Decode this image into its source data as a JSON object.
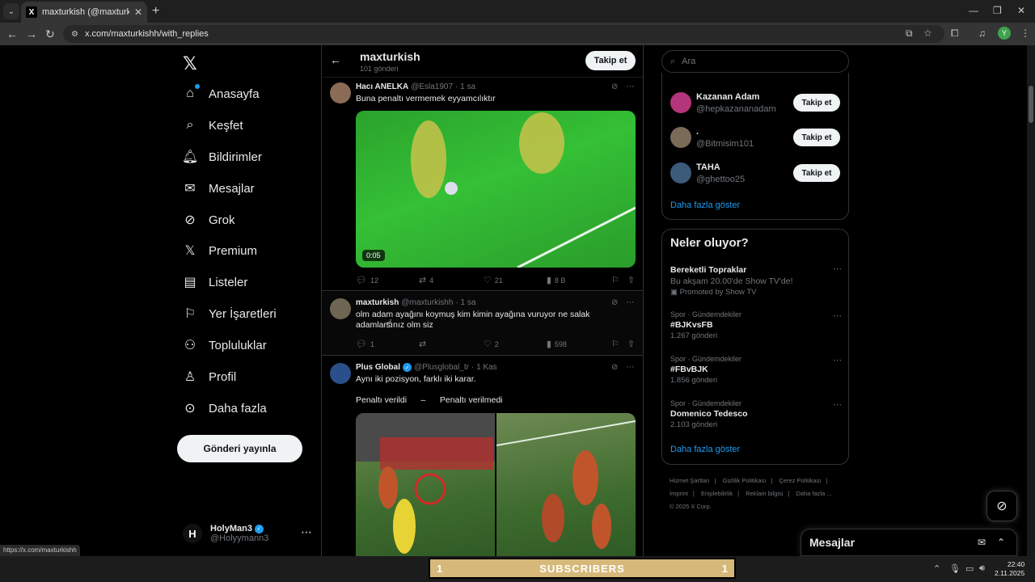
{
  "browser": {
    "tab_title": "maxturkish (@maxturkishh) adlı",
    "url": "x.com/maxturkishh/with_replies",
    "status_url": "https://x.com/maxturkishh",
    "profile_initial": "Y"
  },
  "nav": {
    "items": [
      {
        "label": "Anasayfa",
        "icon": "home-icon"
      },
      {
        "label": "Keşfet",
        "icon": "search-icon"
      },
      {
        "label": "Bildirimler",
        "icon": "bell-icon"
      },
      {
        "label": "Mesajlar",
        "icon": "envelope-icon"
      },
      {
        "label": "Grok",
        "icon": "grok-icon"
      },
      {
        "label": "Premium",
        "icon": "x-icon"
      },
      {
        "label": "Listeler",
        "icon": "list-icon"
      },
      {
        "label": "Yer İşaretleri",
        "icon": "bookmark-icon"
      },
      {
        "label": "Topluluklar",
        "icon": "people-icon"
      },
      {
        "label": "Profil",
        "icon": "person-icon"
      },
      {
        "label": "Daha fazla",
        "icon": "more-circle-icon"
      }
    ],
    "post_button": "Gönderi yayınla",
    "account": {
      "name": "HolyMan3",
      "handle": "@Holyymann3",
      "initial": "H"
    }
  },
  "header": {
    "title": "maxturkish",
    "post_count": "101 gönderi",
    "follow": "Takip et"
  },
  "tweets": [
    {
      "name": "Hacı ANELKA",
      "handle": "@Esla1907",
      "time": "· 1 sa",
      "text": "Buna penaltı vermemek eyyamcılıktır",
      "video_duration": "0:05",
      "replies": "12",
      "reposts": "4",
      "likes": "21",
      "views": "8 B"
    },
    {
      "name": "maxturkish",
      "handle": "@maxturkishh",
      "time": "· 1 sa",
      "text": "olm adam ayağını koymuş kim kimin ayağına vuruyor ne salak adamlarsınız olm siz",
      "replies": "1",
      "reposts": "",
      "likes": "2",
      "views": "598"
    },
    {
      "name": "Plus Global",
      "handle": "@Plusglobal_tr",
      "time": "· 1 Kas",
      "text": "Aynı iki pozisyon, farklı iki karar.",
      "line2": "Penaltı verildi      –      Penaltı verilmedi"
    }
  ],
  "search": {
    "placeholder": "Ara"
  },
  "who_to_follow": {
    "accounts": [
      {
        "name": "Kazanan Adam",
        "handle": "@hepkazananadam"
      },
      {
        "name": ".",
        "handle": "@Bitmisim101"
      },
      {
        "name": "TAHA",
        "handle": "@ghettoo25"
      }
    ],
    "follow": "Takip et",
    "show_more": "Daha fazla göster"
  },
  "trends": {
    "title": "Neler oluyor?",
    "items": [
      {
        "meta": "",
        "name": "Bereketli Topraklar",
        "desc": "Bu akşam 20.00'de Show TV'de!",
        "sub": "Promoted by Show TV"
      },
      {
        "meta": "Spor · Gündemdekiler",
        "name": "#BJKvsFB",
        "sub": "1.267 gönderi"
      },
      {
        "meta": "Spor · Gündemdekiler",
        "name": "#FBvBJK",
        "sub": "1.856 gönderi"
      },
      {
        "meta": "Spor · Gündemdekiler",
        "name": "Domenico Tedesco",
        "sub": "2.103 gönderi"
      }
    ],
    "show_more": "Daha fazla göster"
  },
  "footer": {
    "links": [
      "Hizmet Şartları",
      "|",
      "Gizlilik Politikası",
      "|",
      "Çerez Politikası",
      "|",
      "İmprint",
      "|",
      "Erişilebilirlik",
      "|",
      "Reklam bilgisi",
      "|",
      "Daha fazla ...",
      "© 2025 X Corp."
    ]
  },
  "messages_drawer": {
    "title": "Mesajlar"
  },
  "taskbar": {
    "sub_left": "1",
    "sub_label": "SUBSCRIBERS",
    "sub_right": "1",
    "time": "22:40",
    "date": "2.11.2025"
  },
  "colors": {
    "accent": "#1d9bf0",
    "bg": "#000000",
    "text": "#e7e9ea",
    "muted": "#71767b"
  }
}
